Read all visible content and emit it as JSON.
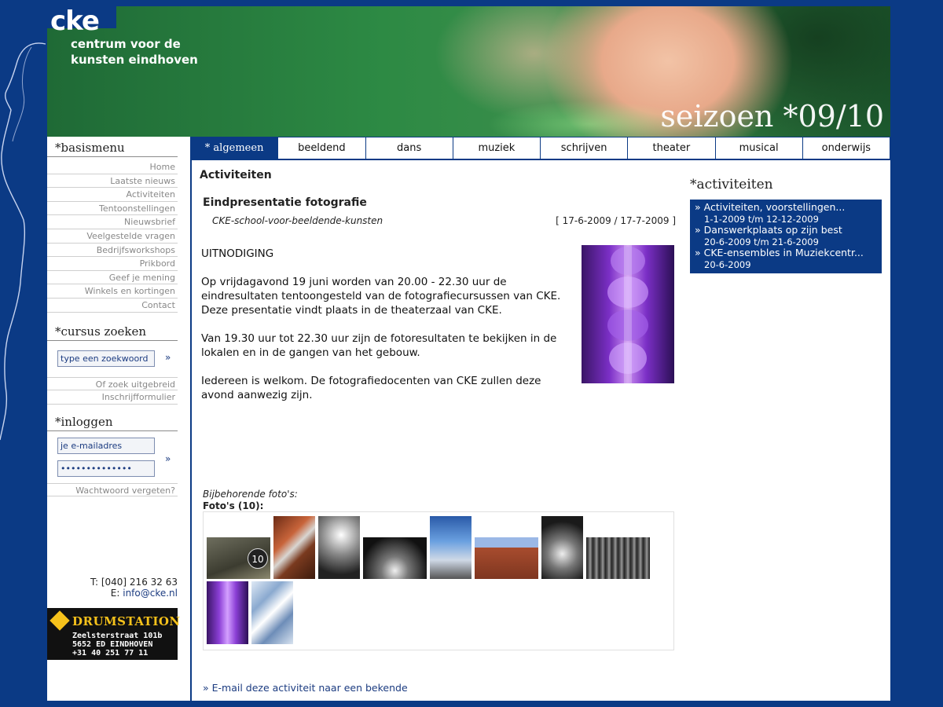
{
  "header": {
    "logo": "cke",
    "subtitle_line1": "centrum voor de",
    "subtitle_line2": "kunsten eindhoven",
    "season": "seizoen *09/10"
  },
  "sidebar": {
    "basismenu_title": "*basismenu",
    "menu": [
      "Home",
      "Laatste nieuws",
      "Activiteiten",
      "Tentoonstellingen",
      "Nieuwsbrief",
      "Veelgestelde vragen",
      "Bedrijfsworkshops",
      "Prikbord",
      "Geef je mening",
      "Winkels en kortingen",
      "Contact"
    ],
    "search_title": "*cursus zoeken",
    "search_placeholder": "type een zoekwoord",
    "search_go": "»",
    "search_links": [
      "Of zoek uitgebreid",
      "Inschrijfformulier"
    ],
    "login_title": "*inloggen",
    "email_placeholder": "je e-mailadres",
    "password_value": "••••••••••••••",
    "login_go": "»",
    "forgot": "Wachtwoord vergeten?",
    "phone": "T: [040] 216 32 63",
    "email_label": "E:",
    "email": "info@cke.nl",
    "ad": {
      "title": "DRUMSTATION",
      "line1": "Zeelsterstraat 101b",
      "line2": "5652 ED EINDHOVEN",
      "line3": "+31 40 251 77 11"
    }
  },
  "nav": {
    "tabs": [
      "* algemeen",
      "beeldend",
      "dans",
      "muziek",
      "schrijven",
      "theater",
      "musical",
      "onderwijs"
    ]
  },
  "main": {
    "section_title": "Activiteiten",
    "event_title": "Eindpresentatie fotografie",
    "organizer": "CKE-school-voor-beeldende-kunsten",
    "dates": "[ 17-6-2009 / 17-7-2009 ]",
    "paragraphs": [
      "UITNODIGING",
      "Op vrijdagavond 19 juni worden van 20.00 - 22.30 uur de eindresultaten tentoongesteld van de fotografiecursussen van CKE. Deze presentatie vindt plaats in de theaterzaal van CKE.",
      "Van 19.30 uur tot 22.30 uur zijn de fotoresultaten te bekijken in de lokalen en in de gangen van het gebouw.",
      "Iedereen is welkom. De fotografiedocenten van CKE zullen deze avond aanwezig zijn."
    ],
    "photos_label": "Bijbehorende foto's:",
    "photos_count": "Foto's (10):",
    "thumb_badge": "10",
    "email_link": "» E-mail deze activiteit naar een bekende"
  },
  "right": {
    "title": "*activiteiten",
    "items": [
      {
        "title": "» Activiteiten, voorstellingen...",
        "date": "1-1-2009 t/m 12-12-2009"
      },
      {
        "title": "» Danswerkplaats op zijn best",
        "date": "20-6-2009 t/m 21-6-2009"
      },
      {
        "title": "» CKE-ensembles in Muziekcentr...",
        "date": "20-6-2009"
      }
    ]
  },
  "colors": {
    "brand_blue": "#0b3a85",
    "accent_yellow": "#f6c21b"
  }
}
